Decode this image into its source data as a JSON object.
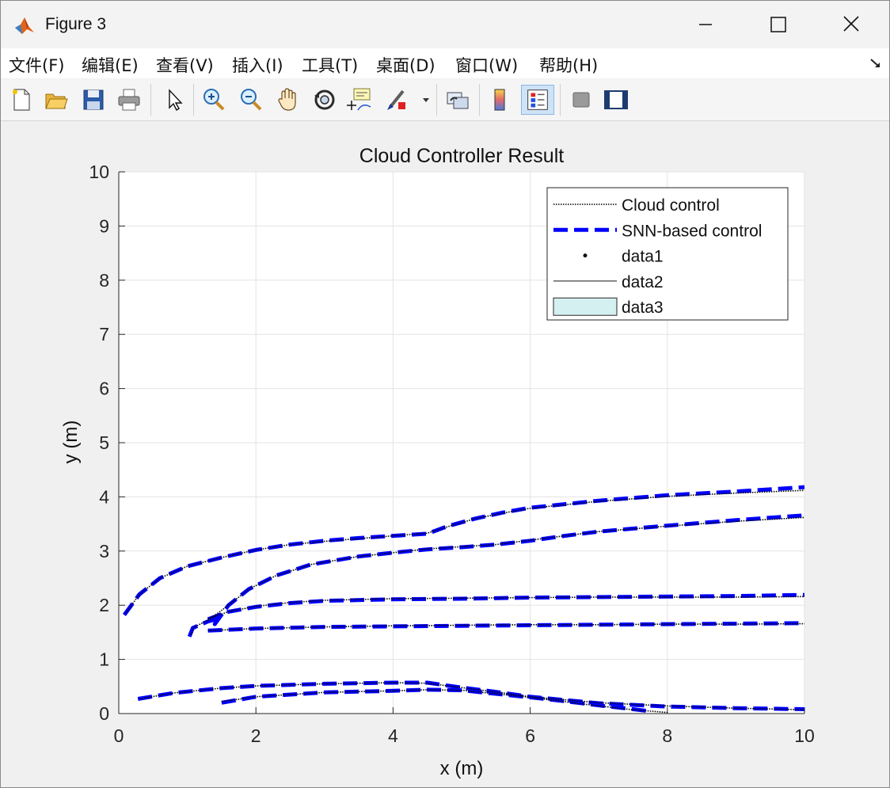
{
  "window": {
    "title": "Figure 3"
  },
  "menu": {
    "items": [
      "文件(F)",
      "编辑(E)",
      "查看(V)",
      "插入(I)",
      "工具(T)",
      "桌面(D)",
      "窗口(W)",
      "帮助(H)"
    ]
  },
  "toolbar": {
    "buttons": [
      {
        "name": "new-figure-icon"
      },
      {
        "name": "open-file-icon"
      },
      {
        "name": "save-icon"
      },
      {
        "name": "print-icon"
      },
      {
        "name": "pointer-icon"
      },
      {
        "name": "zoom-in-icon"
      },
      {
        "name": "zoom-out-icon"
      },
      {
        "name": "pan-hand-icon"
      },
      {
        "name": "rotate-3d-icon"
      },
      {
        "name": "data-cursor-icon"
      },
      {
        "name": "brush-icon"
      },
      {
        "name": "link-plot-icon"
      },
      {
        "name": "colorbar-icon"
      },
      {
        "name": "legend-icon"
      },
      {
        "name": "hide-plot-tools-icon"
      },
      {
        "name": "show-plot-tools-icon"
      }
    ]
  },
  "chart_data": {
    "type": "line",
    "title": "Cloud Controller Result",
    "xlabel": "x (m)",
    "ylabel": "y (m)",
    "xlim": [
      0,
      10
    ],
    "ylim": [
      0,
      10
    ],
    "xticks": [
      "0",
      "2",
      "4",
      "6",
      "8",
      "10"
    ],
    "yticks": [
      "0",
      "1",
      "2",
      "3",
      "4",
      "5",
      "6",
      "7",
      "8",
      "9",
      "10"
    ],
    "grid": true,
    "legend": {
      "placement": "top-right",
      "entries": [
        "Cloud control",
        "SNN-based control",
        "data1",
        "data2",
        "data3"
      ]
    },
    "colors": {
      "cloud": "#000000",
      "snn": "#0000ff",
      "data3": "#d4f0f0"
    },
    "series": [
      {
        "name": "Cloud control",
        "style": "dotted",
        "paths": [
          [
            [
              0.1,
              1.85
            ],
            [
              0.3,
              2.2
            ],
            [
              0.6,
              2.5
            ],
            [
              1.0,
              2.72
            ],
            [
              1.5,
              2.88
            ],
            [
              2.0,
              3.02
            ],
            [
              2.5,
              3.12
            ],
            [
              3.0,
              3.18
            ],
            [
              3.5,
              3.23
            ],
            [
              4.0,
              3.28
            ],
            [
              4.5,
              3.33
            ],
            [
              4.8,
              3.45
            ],
            [
              5.2,
              3.6
            ],
            [
              5.6,
              3.7
            ],
            [
              6.0,
              3.79
            ],
            [
              7.0,
              3.92
            ],
            [
              8.0,
              4.01
            ],
            [
              9.0,
              4.07
            ],
            [
              10.0,
              4.12
            ]
          ],
          [
            [
              1.05,
              1.45
            ],
            [
              1.1,
              1.6
            ],
            [
              1.3,
              1.72
            ],
            [
              1.6,
              2.0
            ],
            [
              1.9,
              2.3
            ],
            [
              2.3,
              2.55
            ],
            [
              2.8,
              2.75
            ],
            [
              3.5,
              2.9
            ],
            [
              4.0,
              2.97
            ],
            [
              4.5,
              3.04
            ],
            [
              5.0,
              3.08
            ],
            [
              5.5,
              3.12
            ],
            [
              6.0,
              3.2
            ],
            [
              6.5,
              3.28
            ],
            [
              7.0,
              3.36
            ],
            [
              8.0,
              3.46
            ],
            [
              9.0,
              3.55
            ],
            [
              10.0,
              3.62
            ]
          ],
          [
            [
              1.3,
              1.75
            ],
            [
              1.6,
              1.88
            ],
            [
              2.0,
              1.98
            ],
            [
              2.5,
              2.05
            ],
            [
              3.0,
              2.09
            ],
            [
              4.0,
              2.12
            ],
            [
              5.0,
              2.13
            ],
            [
              6.0,
              2.14
            ],
            [
              7.0,
              2.15
            ],
            [
              8.0,
              2.15
            ],
            [
              9.0,
              2.15
            ],
            [
              10.0,
              2.16
            ]
          ],
          [
            [
              1.3,
              1.53
            ],
            [
              2.0,
              1.57
            ],
            [
              3.0,
              1.6
            ],
            [
              4.0,
              1.62
            ],
            [
              5.0,
              1.63
            ],
            [
              6.0,
              1.64
            ],
            [
              7.0,
              1.64
            ],
            [
              8.0,
              1.65
            ],
            [
              9.0,
              1.65
            ],
            [
              10.0,
              1.66
            ]
          ],
          [
            [
              0.3,
              0.27
            ],
            [
              0.8,
              0.38
            ],
            [
              1.5,
              0.47
            ],
            [
              2.0,
              0.51
            ],
            [
              3.0,
              0.55
            ],
            [
              4.0,
              0.57
            ],
            [
              4.5,
              0.56
            ],
            [
              5.0,
              0.48
            ],
            [
              5.5,
              0.4
            ],
            [
              6.0,
              0.31
            ],
            [
              7.0,
              0.2
            ],
            [
              8.0,
              0.14
            ],
            [
              9.0,
              0.1
            ],
            [
              10.0,
              0.07
            ]
          ],
          [
            [
              1.5,
              0.22
            ],
            [
              2.0,
              0.31
            ],
            [
              3.0,
              0.39
            ],
            [
              4.0,
              0.42
            ],
            [
              4.5,
              0.44
            ],
            [
              5.0,
              0.43
            ],
            [
              6.0,
              0.3
            ],
            [
              6.5,
              0.22
            ],
            [
              7.0,
              0.14
            ],
            [
              7.5,
              0.07
            ],
            [
              8.0,
              0.02
            ]
          ]
        ]
      },
      {
        "name": "SNN-based control",
        "style": "dashed",
        "paths": [
          [
            [
              0.08,
              1.82
            ],
            [
              0.3,
              2.2
            ],
            [
              0.6,
              2.5
            ],
            [
              1.0,
              2.72
            ],
            [
              1.5,
              2.88
            ],
            [
              2.0,
              3.02
            ],
            [
              2.5,
              3.12
            ],
            [
              3.0,
              3.19
            ],
            [
              3.5,
              3.24
            ],
            [
              4.0,
              3.28
            ],
            [
              4.5,
              3.32
            ],
            [
              4.8,
              3.46
            ],
            [
              5.2,
              3.6
            ],
            [
              5.6,
              3.71
            ],
            [
              6.0,
              3.8
            ],
            [
              7.0,
              3.93
            ],
            [
              8.0,
              4.03
            ],
            [
              9.0,
              4.1
            ],
            [
              10.0,
              4.18
            ]
          ],
          [
            [
              1.03,
              1.42
            ],
            [
              1.08,
              1.58
            ],
            [
              1.3,
              1.7
            ],
            [
              1.45,
              1.75
            ],
            [
              1.4,
              1.65
            ],
            [
              1.6,
              2.0
            ],
            [
              1.9,
              2.3
            ],
            [
              2.3,
              2.55
            ],
            [
              2.8,
              2.75
            ],
            [
              3.5,
              2.9
            ],
            [
              4.0,
              2.97
            ],
            [
              4.5,
              3.03
            ],
            [
              5.0,
              3.07
            ],
            [
              5.5,
              3.12
            ],
            [
              6.0,
              3.19
            ],
            [
              6.5,
              3.28
            ],
            [
              7.0,
              3.36
            ],
            [
              8.0,
              3.47
            ],
            [
              9.0,
              3.57
            ],
            [
              10.0,
              3.66
            ]
          ],
          [
            [
              1.3,
              1.74
            ],
            [
              1.6,
              1.88
            ],
            [
              2.0,
              1.97
            ],
            [
              2.5,
              2.04
            ],
            [
              3.0,
              2.08
            ],
            [
              4.0,
              2.11
            ],
            [
              5.0,
              2.12
            ],
            [
              6.0,
              2.14
            ],
            [
              7.0,
              2.15
            ],
            [
              8.0,
              2.16
            ],
            [
              9.0,
              2.17
            ],
            [
              10.0,
              2.19
            ]
          ],
          [
            [
              1.3,
              1.53
            ],
            [
              2.0,
              1.57
            ],
            [
              3.0,
              1.6
            ],
            [
              4.0,
              1.61
            ],
            [
              5.0,
              1.62
            ],
            [
              6.0,
              1.63
            ],
            [
              7.0,
              1.64
            ],
            [
              8.0,
              1.65
            ],
            [
              9.0,
              1.66
            ],
            [
              10.0,
              1.67
            ]
          ],
          [
            [
              0.28,
              0.27
            ],
            [
              0.8,
              0.38
            ],
            [
              1.5,
              0.47
            ],
            [
              2.0,
              0.51
            ],
            [
              3.0,
              0.55
            ],
            [
              4.0,
              0.57
            ],
            [
              4.5,
              0.57
            ],
            [
              5.0,
              0.48
            ],
            [
              5.5,
              0.4
            ],
            [
              6.0,
              0.31
            ],
            [
              7.0,
              0.19
            ],
            [
              8.0,
              0.13
            ],
            [
              9.0,
              0.1
            ],
            [
              10.0,
              0.08
            ]
          ],
          [
            [
              1.5,
              0.2
            ],
            [
              2.0,
              0.31
            ],
            [
              3.0,
              0.39
            ],
            [
              4.0,
              0.42
            ],
            [
              4.5,
              0.44
            ],
            [
              5.0,
              0.43
            ],
            [
              6.0,
              0.3
            ],
            [
              6.5,
              0.23
            ],
            [
              7.0,
              0.15
            ],
            [
              7.5,
              0.08
            ],
            [
              7.7,
              0.05
            ]
          ]
        ]
      }
    ]
  }
}
